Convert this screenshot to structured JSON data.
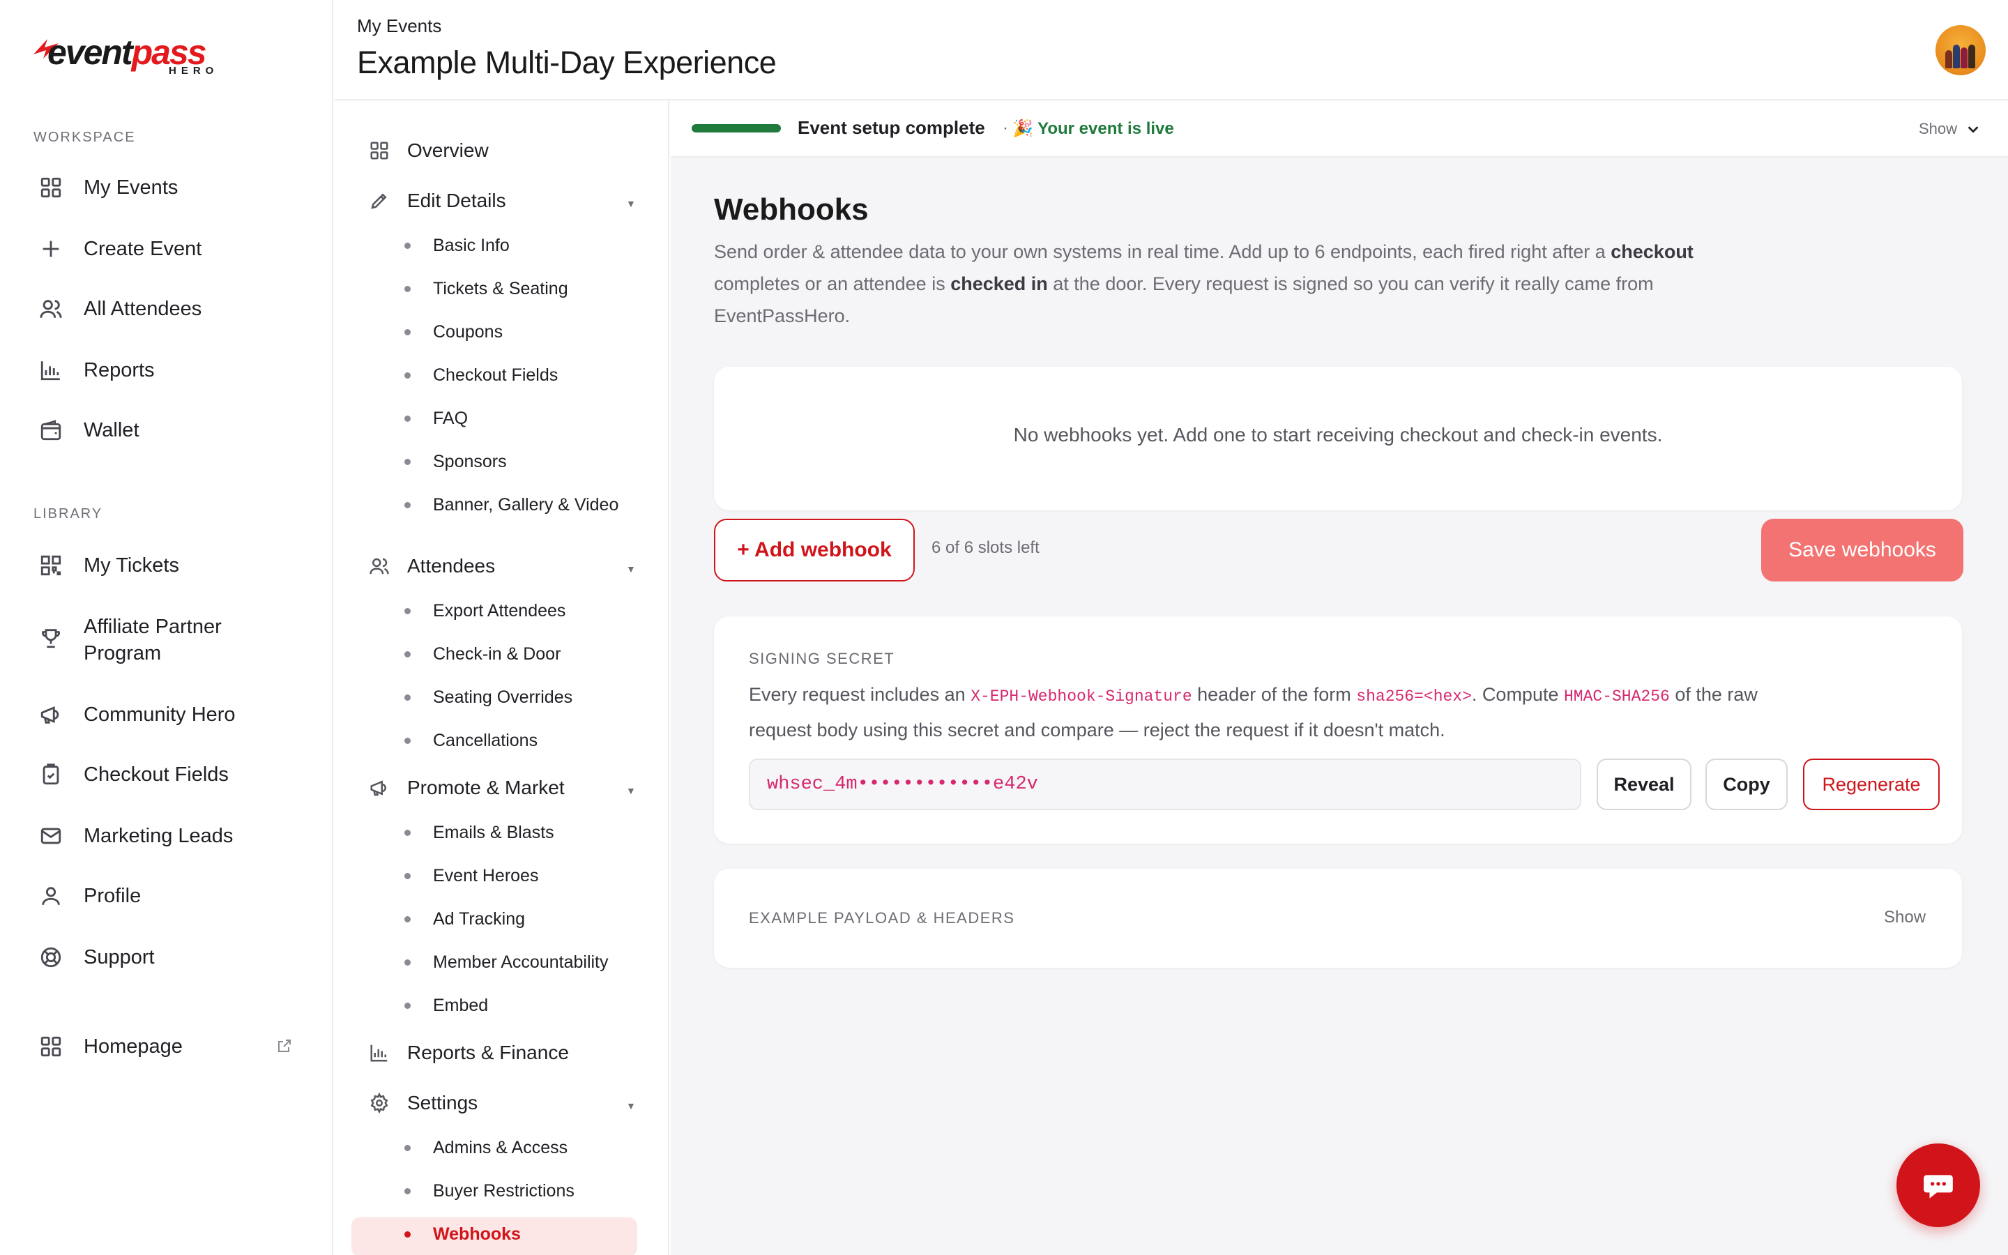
{
  "brand": {
    "word_main": "event",
    "word_accent": "pass",
    "sub": "HERO"
  },
  "sidebar": {
    "workspace_label": "WORKSPACE",
    "library_label": "LIBRARY",
    "workspace_items": [
      {
        "label": "My Events",
        "icon": "grid-icon"
      },
      {
        "label": "Create Event",
        "icon": "plus-icon"
      },
      {
        "label": "All Attendees",
        "icon": "users-icon"
      },
      {
        "label": "Reports",
        "icon": "bar-chart-icon"
      },
      {
        "label": "Wallet",
        "icon": "wallet-icon"
      }
    ],
    "library_items": [
      {
        "label": "My Tickets",
        "icon": "qr-code-icon"
      },
      {
        "label": "Affiliate Partner Program",
        "icon": "trophy-icon"
      },
      {
        "label": "Community Hero",
        "icon": "megaphone-icon"
      },
      {
        "label": "Checkout Fields",
        "icon": "clipboard-check-icon"
      },
      {
        "label": "Marketing Leads",
        "icon": "mail-icon"
      },
      {
        "label": "Profile",
        "icon": "user-icon"
      },
      {
        "label": "Support",
        "icon": "lifebuoy-icon"
      }
    ],
    "homepage": {
      "label": "Homepage",
      "icon": "grid-icon"
    }
  },
  "header": {
    "breadcrumb": "My Events",
    "title": "Example Multi-Day Experience"
  },
  "subnav": {
    "overview": "Overview",
    "edit_details": {
      "label": "Edit Details",
      "items": [
        "Basic Info",
        "Tickets & Seating",
        "Coupons",
        "Checkout Fields",
        "FAQ",
        "Sponsors",
        "Banner, Gallery & Video"
      ]
    },
    "attendees": {
      "label": "Attendees",
      "items": [
        "Export Attendees",
        "Check-in & Door",
        "Seating Overrides",
        "Cancellations"
      ]
    },
    "promote": {
      "label": "Promote & Market",
      "items": [
        "Emails & Blasts",
        "Event Heroes",
        "Ad Tracking",
        "Member Accountability",
        "Embed"
      ]
    },
    "reports_finance": "Reports & Finance",
    "settings": {
      "label": "Settings",
      "items": [
        "Admins & Access",
        "Buyer Restrictions",
        "Webhooks"
      ]
    },
    "active_item": "Webhooks"
  },
  "status": {
    "setup": "Event setup complete",
    "separator": "·",
    "live": "🎉 Your event is live",
    "show": "Show",
    "progress": 1.0
  },
  "webhooks": {
    "title": "Webhooks",
    "desc_1": "Send order & attendee data to your own systems in real time. Add up to 6 endpoints, each fired right after a ",
    "desc_checkout": "checkout",
    "desc_2": " completes or an attendee is ",
    "desc_checked": "checked in",
    "desc_3": " at the door. Every request is signed so you can verify it really came from EventPassHero.",
    "empty": "No webhooks yet. Add one to start receiving checkout and check-in events.",
    "add_button": "+ Add webhook",
    "slots": "6 of 6 slots left",
    "save_button": "Save webhooks"
  },
  "secret": {
    "label": "SIGNING SECRET",
    "d1": "Every request includes an ",
    "c1": "X-EPH-Webhook-Signature",
    "d2": " header of the form ",
    "c2": "sha256=<hex>",
    "d3": ". Compute ",
    "c3": "HMAC-SHA256",
    "d4": " of the raw request body using this secret and compare — reject the request if it doesn't match.",
    "value": "whsec_4m••••••••••••e42v",
    "reveal": "Reveal",
    "copy": "Copy",
    "regenerate": "Regenerate"
  },
  "payload": {
    "label": "EXAMPLE PAYLOAD & HEADERS",
    "show": "Show"
  },
  "colors": {
    "accent": "#d0141a",
    "accent_soft": "#fde6e6",
    "save_button": "#f37372",
    "live_green": "#1f7a3c",
    "code_pink": "#d6286e"
  }
}
